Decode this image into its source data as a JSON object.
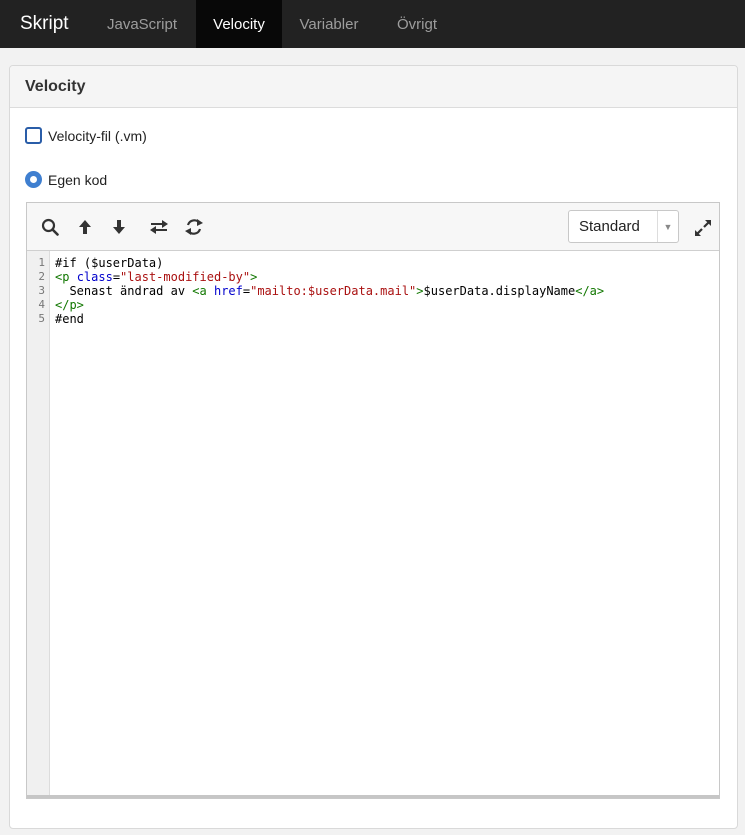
{
  "nav": {
    "brand": "Skript",
    "tabs": [
      {
        "label": "JavaScript",
        "active": false
      },
      {
        "label": "Velocity",
        "active": true
      },
      {
        "label": "Variabler",
        "active": false
      },
      {
        "label": "Övrigt",
        "active": false
      }
    ]
  },
  "panel": {
    "title": "Velocity",
    "options": {
      "file_label": "Velocity-fil (.vm)",
      "file_checked": false,
      "custom_label": "Egen kod",
      "custom_selected": true
    }
  },
  "editor": {
    "toolbar": {
      "icons": [
        "search-icon",
        "arrow-up-icon",
        "arrow-down-icon",
        "swap-icon",
        "refresh-icon",
        "expand-icon"
      ],
      "theme_select": "Standard"
    },
    "lines": [
      {
        "number": "1",
        "tokens": [
          {
            "t": "#if ($userData)",
            "c": "plain"
          }
        ]
      },
      {
        "number": "2",
        "tokens": [
          {
            "t": "<p ",
            "c": "tag"
          },
          {
            "t": "class",
            "c": "attr"
          },
          {
            "t": "=",
            "c": "plain"
          },
          {
            "t": "\"last-modified-by\"",
            "c": "str"
          },
          {
            "t": ">",
            "c": "tag"
          }
        ]
      },
      {
        "number": "3",
        "tokens": [
          {
            "t": "  Senast ändrad av ",
            "c": "plain"
          },
          {
            "t": "<a ",
            "c": "tag"
          },
          {
            "t": "href",
            "c": "attr"
          },
          {
            "t": "=",
            "c": "plain"
          },
          {
            "t": "\"mailto:$userData.mail\"",
            "c": "str"
          },
          {
            "t": ">",
            "c": "tag"
          },
          {
            "t": "$userData.displayName",
            "c": "plain"
          },
          {
            "t": "</a>",
            "c": "tag"
          }
        ]
      },
      {
        "number": "4",
        "tokens": [
          {
            "t": "</p>",
            "c": "tag"
          }
        ]
      },
      {
        "number": "5",
        "tokens": [
          {
            "t": "#end",
            "c": "plain"
          }
        ]
      }
    ]
  },
  "colors": {
    "navbar_bg": "#222222",
    "active_tab_bg": "#080808",
    "radio_accent": "#3f7fd0",
    "syntax_tag": "#117700",
    "syntax_attr": "#0000cc",
    "syntax_string": "#aa1111"
  }
}
